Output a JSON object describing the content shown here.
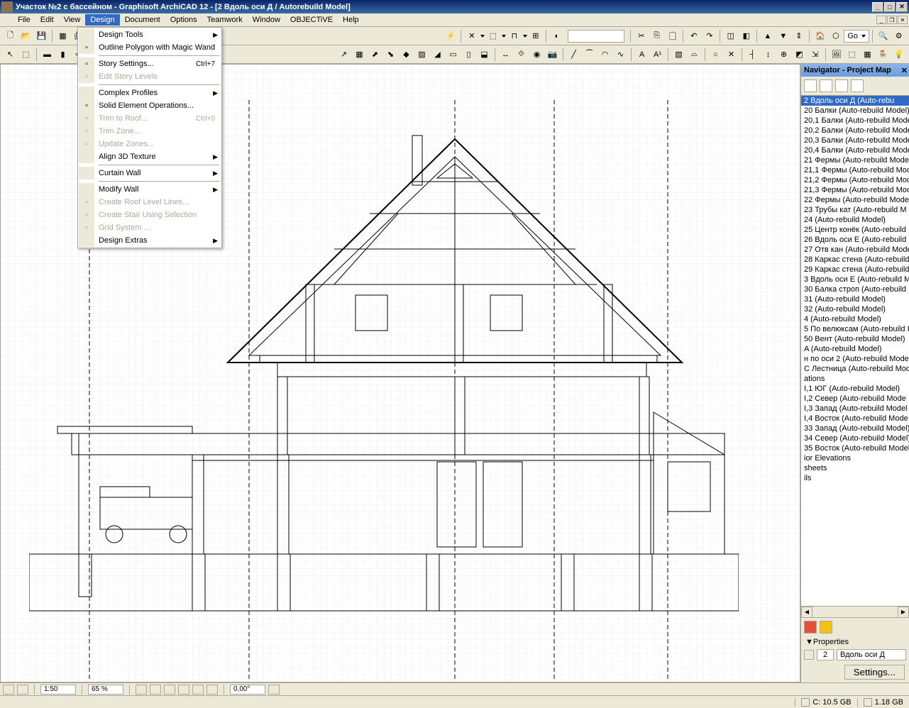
{
  "window": {
    "title": "Участок №2 с бассейном   - Graphisoft ArchiCAD 12 - [2 Вдоль оси Д / Autorebuild Model]"
  },
  "menubar": {
    "items": [
      "File",
      "Edit",
      "View",
      "Design",
      "Document",
      "Options",
      "Teamwork",
      "Window",
      "OBJECTiVE",
      "Help"
    ]
  },
  "design_menu": {
    "items": [
      {
        "label": "Design Tools",
        "type": "sub"
      },
      {
        "label": "Outline Polygon with Magic Wand",
        "icon": "wand"
      },
      {
        "sep": true
      },
      {
        "label": "Story Settings...",
        "icon": "stories",
        "shortcut": "Ctrl+7"
      },
      {
        "label": "Edit Story Levels",
        "icon": "edit-story",
        "disabled": true
      },
      {
        "sep": true
      },
      {
        "label": "Complex Profiles",
        "type": "sub"
      },
      {
        "label": "Solid Element Operations...",
        "icon": "solid"
      },
      {
        "label": "Trim to Roof...",
        "icon": "trim-roof",
        "disabled": true,
        "shortcut": "Ctrl+0"
      },
      {
        "label": "Trim Zone...",
        "icon": "trim-zone",
        "disabled": true
      },
      {
        "label": "Update Zones...",
        "icon": "update",
        "disabled": true
      },
      {
        "label": "Align 3D Texture",
        "type": "sub"
      },
      {
        "sep": true
      },
      {
        "label": "Curtain Wall",
        "type": "sub"
      },
      {
        "sep": true
      },
      {
        "label": "Modify Wall",
        "type": "sub"
      },
      {
        "label": "Create Roof Level Lines...",
        "icon": "roof-lines",
        "disabled": true
      },
      {
        "label": "Create Stair Using Selection",
        "icon": "stair",
        "disabled": true
      },
      {
        "label": "Grid System ...",
        "icon": "grid",
        "disabled": true
      },
      {
        "label": "Design Extras",
        "type": "sub"
      }
    ]
  },
  "toolbar_go": "Go",
  "navigator": {
    "title": "Navigator - Project Map",
    "items": [
      "2 Вдоль оси Д (Auto-rebu",
      "20 Балки (Auto-rebuild Model)",
      "20,1 Балки (Auto-rebuild Mode",
      "20,2 Балки (Auto-rebuild Mode",
      "20,3 Балки (Auto-rebuild Mode",
      "20,4 Балки (Auto-rebuild Mode",
      "21 Фермы (Auto-rebuild Model)",
      "21,1 Фермы (Auto-rebuild Mod",
      "21,2 Фермы (Auto-rebuild Mod",
      "21,3 Фермы (Auto-rebuild Mod",
      "22 Фермы (Auto-rebuild Model)",
      "23 Трубы кат (Auto-rebuild M",
      "24 (Auto-rebuild Model)",
      "25 Центр конёк (Auto-rebuild",
      "26 Вдоль оси Е (Auto-rebuild I",
      "27 Отв кан (Auto-rebuild Mode",
      "28 Каркас стена (Auto-rebuild",
      "29 Каркас стена (Auto-rebuild",
      "3 Вдоль оси Е (Auto-rebuild M",
      "30 Балка строп (Auto-rebuild",
      "31 (Auto-rebuild Model)",
      "32 (Auto-rebuild Model)",
      "4 (Auto-rebuild Model)",
      "5 По велюксам (Auto-rebuild I",
      "50 Вент (Auto-rebuild Model)",
      "A (Auto-rebuild Model)",
      "н по оси 2 (Auto-rebuild Mode",
      "С Лестница (Auto-rebuild Mod",
      "ations",
      "I,1 ЮГ (Auto-rebuild Model)",
      "I,2 Север (Auto-rebuild Mode",
      "I,3 Запад (Auto-rebuild Model",
      "I,4 Восток (Auto-rebuild Mode",
      "33 Запад (Auto-rebuild Model)",
      "34 Север (Auto-rebuild Model)",
      "35 Восток (Auto-rebuild Model",
      "ior Elevations",
      "sheets",
      "ils"
    ]
  },
  "properties": {
    "title": "Properties",
    "id": "2",
    "name": "Вдоль оси Д",
    "settings_btn": "Settings..."
  },
  "status": {
    "disk_c": "C: 10.5 GB",
    "mem": "1.18 GB"
  },
  "bottom": {
    "scale": "1:50",
    "zoom": "65 %",
    "angle": "0,00°"
  }
}
